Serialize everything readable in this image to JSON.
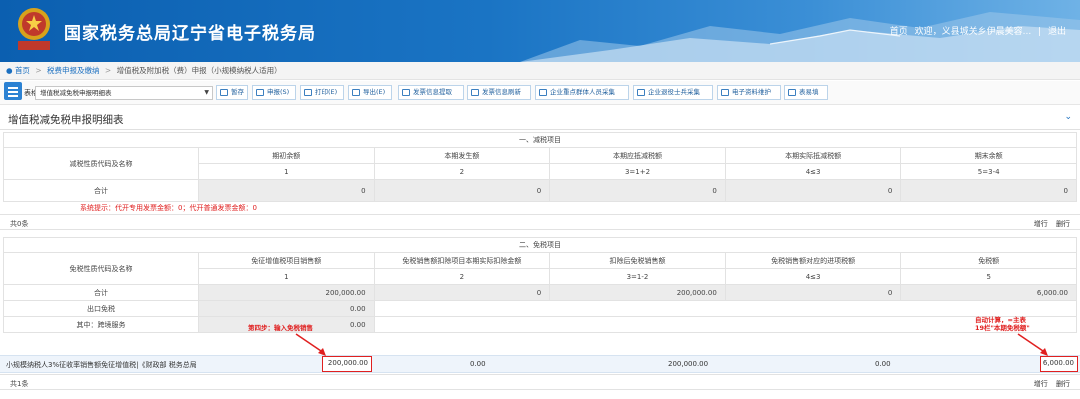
{
  "header": {
    "title": "国家税务总局辽宁省电子税务局",
    "emblem_text": "中国税务",
    "links": [
      "首页",
      "欢迎，义县城关乡伊晨美容...",
      "|",
      "退出"
    ]
  },
  "breadcrumb": [
    "首页",
    "税费申报及缴纳",
    "增值税及附加税（费）申报（小规模纳税人适用）"
  ],
  "toolbar": {
    "label": "表格:",
    "select_value": "增值税减免税申报明细表",
    "buttons": [
      "暂存",
      "申报(S)",
      "打印(E)",
      "导出(E)",
      "发票信息提取",
      "发票信息刷新",
      "企业重点群体人员采集",
      "企业退役士兵采集",
      "电子资料维护",
      "表易填"
    ]
  },
  "page": {
    "title": "增值税减免税申报明细表"
  },
  "section1": {
    "caption": "一、减税项目",
    "name_header": "减税性质代码及名称",
    "columns": [
      "期初余额",
      "本期发生额",
      "本期应抵减税额",
      "本期实际抵减税额",
      "期末余额"
    ],
    "col_numbers": [
      "1",
      "2",
      "3=1+2",
      "4≤3",
      "5=3-4"
    ],
    "total_label": "合计",
    "total_values": [
      "0",
      "0",
      "0",
      "0",
      "0"
    ],
    "hint": "系统提示：代开专用发票金额：0；代开普通发票金额：0",
    "count": "共0条",
    "actions": [
      "增行",
      "删行"
    ]
  },
  "section2": {
    "caption": "二、免税项目",
    "name_header": "免税性质代码及名称",
    "columns": [
      "免征增值税项目销售额",
      "免税销售额扣除项目本期实际扣除金额",
      "扣除后免税销售额",
      "免税销售额对应的进项税额",
      "免税额"
    ],
    "col_numbers": [
      "1",
      "2",
      "3=1-2",
      "4≤3",
      "5"
    ],
    "total_label": "合计",
    "total_values": [
      "200,000.00",
      "0",
      "200,000.00",
      "0",
      "6,000.00"
    ],
    "export_label": "出口免税",
    "export_value": "0.00",
    "cross_label": "其中：跨境服务",
    "cross_value": "0.00",
    "row": {
      "name": "小规模纳税人3%征收率销售额免征增值税|《财政部 税务总局...",
      "values": [
        "200,000.00",
        "0.00",
        "200,000.00",
        "0.00",
        "6,000.00"
      ]
    },
    "count": "共1条",
    "actions": [
      "增行",
      "删行"
    ]
  },
  "annotations": {
    "step4": "第四步：输入免税销售",
    "auto_line1": "自动计算，=主表",
    "auto_line2": "19栏\"本期免税额\""
  },
  "colors": {
    "brand": "#1a74c4",
    "highlight": "#e02020"
  }
}
